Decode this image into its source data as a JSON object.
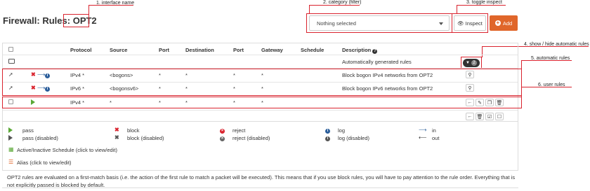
{
  "header": {
    "title_prefix": "Firewall: Rules:",
    "interface": "OPT2"
  },
  "callouts": {
    "interface_name": "1. interface name",
    "category_filter": "2. category (filter)",
    "toggle_inspect": "3. toggle inspect",
    "show_hide_automatic": "4. show / hide automatic rules",
    "automatic_rules": "5. automatic rules",
    "user_rules": "6. user rules"
  },
  "toolbar": {
    "category_selected": "Nothing selected",
    "inspect_label": "Inspect",
    "add_label": "Add"
  },
  "table": {
    "columns": [
      "Protocol",
      "Source",
      "Port",
      "Destination",
      "Port",
      "Gateway",
      "Schedule",
      "Description"
    ],
    "auto_row_description": "Automatically generated rules",
    "auto_count": "2",
    "rows": [
      {
        "protocol": "IPv4 *",
        "source": "<bogons>",
        "port": "*",
        "destination": "*",
        "dport": "*",
        "gateway": "*",
        "schedule": "",
        "description": "Block bogon IPv4 networks from OPT2"
      },
      {
        "protocol": "IPv6 *",
        "source": "<bogonsv6>",
        "port": "*",
        "destination": "*",
        "dport": "*",
        "gateway": "*",
        "schedule": "",
        "description": "Block bogon IPv6 networks from OPT2"
      },
      {
        "protocol": "IPv4 *",
        "source": "*",
        "port": "*",
        "destination": "*",
        "dport": "*",
        "gateway": "*",
        "schedule": "",
        "description": ""
      }
    ]
  },
  "legend": {
    "pass": "pass",
    "pass_disabled": "pass (disabled)",
    "block": "block",
    "block_disabled": "block (disabled)",
    "reject": "reject",
    "reject_disabled": "reject (disabled)",
    "log": "log",
    "log_disabled": "log (disabled)",
    "in": "in",
    "out": "out",
    "schedule": "Active/Inactive Schedule (click to view/edit)",
    "alias": "Alias (click to view/edit)"
  },
  "footer_note": "OPT2 rules are evaluated on a first-match basis (i.e. the action of the first rule to match a packet will be executed). This means that if you use block rules, you will have to pay attention to the rule order. Everything that is not explicitly passed is blocked by default.",
  "colors": {
    "accent_red": "#d9232e",
    "add_button": "#e0662a",
    "pass_green": "#5aa836",
    "info_blue": "#2a5d9a"
  }
}
